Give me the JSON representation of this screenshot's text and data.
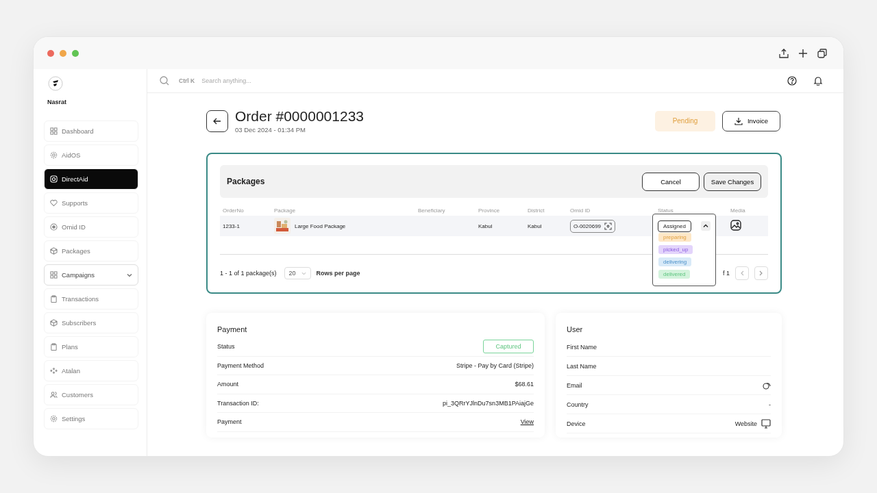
{
  "user": {
    "name": "Nasrat"
  },
  "sidebar": {
    "items": [
      {
        "label": "Dashboard",
        "kind": "link",
        "selected": false
      },
      {
        "label": "AidOS",
        "kind": "link",
        "selected": false
      },
      {
        "label": "DirectAid",
        "kind": "link",
        "selected": true
      },
      {
        "label": "Supports",
        "kind": "link",
        "selected": false
      },
      {
        "label": "Omid ID",
        "kind": "link",
        "selected": false
      },
      {
        "label": "Packages",
        "kind": "link",
        "selected": false
      },
      {
        "label": "Campaigns",
        "kind": "group",
        "selected": false
      },
      {
        "label": "Transactions",
        "kind": "link",
        "selected": false
      },
      {
        "label": "Subscribers",
        "kind": "link",
        "selected": false
      },
      {
        "label": "Plans",
        "kind": "link",
        "selected": false
      },
      {
        "label": "Atalan",
        "kind": "link",
        "selected": false
      },
      {
        "label": "Customers",
        "kind": "link",
        "selected": false
      },
      {
        "label": "Settings",
        "kind": "link",
        "selected": false
      }
    ]
  },
  "search": {
    "shortcut": "Ctrl K",
    "placeholder": "Search anything..."
  },
  "order": {
    "title": "Order #0000001233",
    "date": "03 Dec 2024 - 01:34 PM",
    "status": "Pending",
    "invoice_button": "Invoice"
  },
  "packages": {
    "title": "Packages",
    "buttons": [
      "Cancel",
      "Save Changes"
    ],
    "columns": [
      "OrderNo",
      "Package",
      "Beneficiary",
      "Province",
      "District",
      "Omid ID",
      "Status",
      "Media"
    ],
    "rows": [
      {
        "order_no": "1233-1",
        "package": "Large Food Package",
        "province": "Kabul",
        "district": "Kabul",
        "omid_id": "O-0020699",
        "status": "Assigned",
        "expanded": true,
        "status_options": [
          {
            "label": "preparing",
            "color": "#fde7c7"
          },
          {
            "label": "picked_up",
            "color": "#e3d4fb"
          },
          {
            "label": "delivering",
            "color": "#d8eaf8"
          },
          {
            "label": "delivered",
            "color": "#d3f3dc"
          }
        ]
      }
    ],
    "footer": {
      "range": "1 - 1 of 1 package(s)",
      "rows_per_page": "20",
      "rows_label": "Rows per page",
      "page": "f 1"
    }
  },
  "payment": {
    "title": "Payment",
    "rows": [
      {
        "label": "Status",
        "value": "Captured",
        "kind": "badge"
      },
      {
        "label": "Payment Method",
        "value": "Stripe - Pay by Card (Stripe)",
        "kind": "text"
      },
      {
        "label": "Amount",
        "value": "$68.61",
        "kind": "text"
      },
      {
        "label": "Transaction ID:",
        "value": "pi_3QRrYJlnDu7sn3MB1PAiajGe",
        "kind": "text"
      },
      {
        "label": "Payment",
        "value": "View",
        "kind": "link"
      }
    ]
  },
  "user_card": {
    "title": "User",
    "rows": [
      {
        "label": "First Name",
        "kind": "text"
      },
      {
        "label": "Last Name",
        "kind": "text"
      },
      {
        "label": "Email",
        "kind": "copy"
      },
      {
        "label": "Country",
        "value": "-",
        "kind": "text"
      },
      {
        "label": "Device",
        "value": "Website",
        "kind": "device"
      }
    ]
  }
}
